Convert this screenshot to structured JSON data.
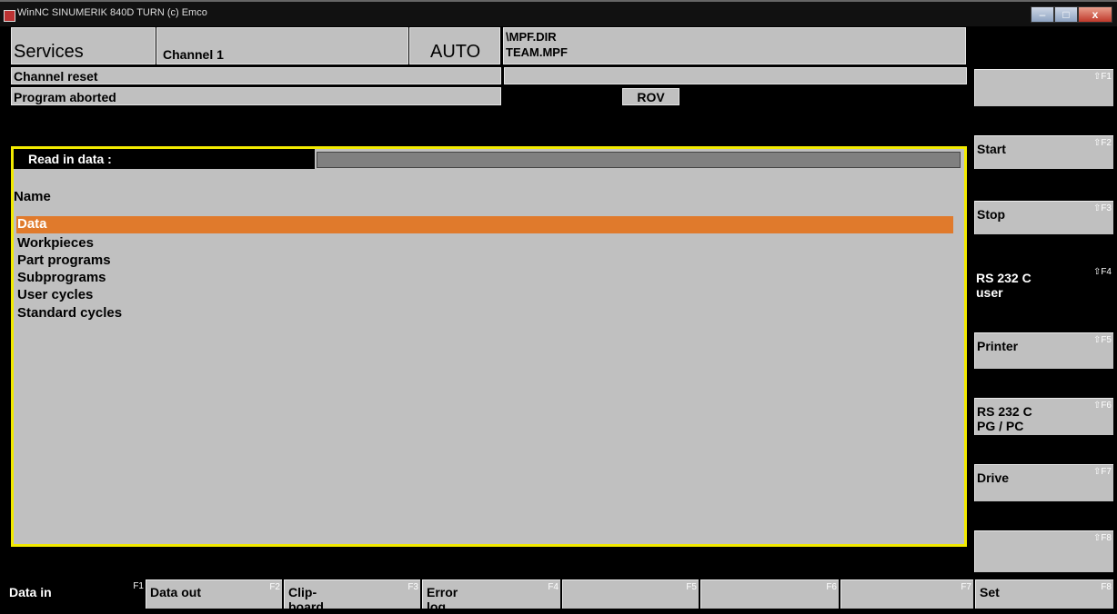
{
  "window": {
    "title": "WinNC SINUMERIK 840D TURN (c) Emco",
    "minimize": "–",
    "maximize": "□",
    "close": "x"
  },
  "header": {
    "area": "Services",
    "channel": "Channel 1",
    "mode": "AUTO",
    "dir": "\\MPF.DIR",
    "program": "TEAM.MPF",
    "status1": "Channel reset",
    "status2": "Program aborted",
    "rov": "ROV"
  },
  "panel": {
    "title": "Read in data :",
    "column": "Name",
    "items": [
      "Data",
      "Workpieces",
      "Part programs",
      "Subprograms",
      "User cycles",
      "Standard cycles"
    ],
    "selected_index": 0
  },
  "vsoftkeys": [
    {
      "label": "",
      "key": "⇧F1"
    },
    {
      "label": "Start",
      "key": "⇧F2"
    },
    {
      "label": "Stop",
      "key": "⇧F3"
    },
    {
      "label": "RS 232 C\nuser",
      "key": "⇧F4"
    },
    {
      "label": "Printer",
      "key": "⇧F5"
    },
    {
      "label": "RS 232 C\nPG / PC",
      "key": "⇧F6"
    },
    {
      "label": "Drive",
      "key": "⇧F7"
    },
    {
      "label": "",
      "key": "⇧F8"
    }
  ],
  "hsoftkeys": [
    {
      "label": "Data in",
      "key": "F1"
    },
    {
      "label": "Data out",
      "key": "F2"
    },
    {
      "label": "Clip-\nboard",
      "key": "F3"
    },
    {
      "label": "Error\nlog",
      "key": "F4"
    },
    {
      "label": "",
      "key": "F5"
    },
    {
      "label": "",
      "key": "F6"
    },
    {
      "label": "",
      "key": "F7"
    },
    {
      "label": "Set",
      "key": "F8"
    }
  ],
  "colors": {
    "highlight": "#e07a2c",
    "frame": "#f2ea00",
    "panel": "#c0c0c0"
  }
}
